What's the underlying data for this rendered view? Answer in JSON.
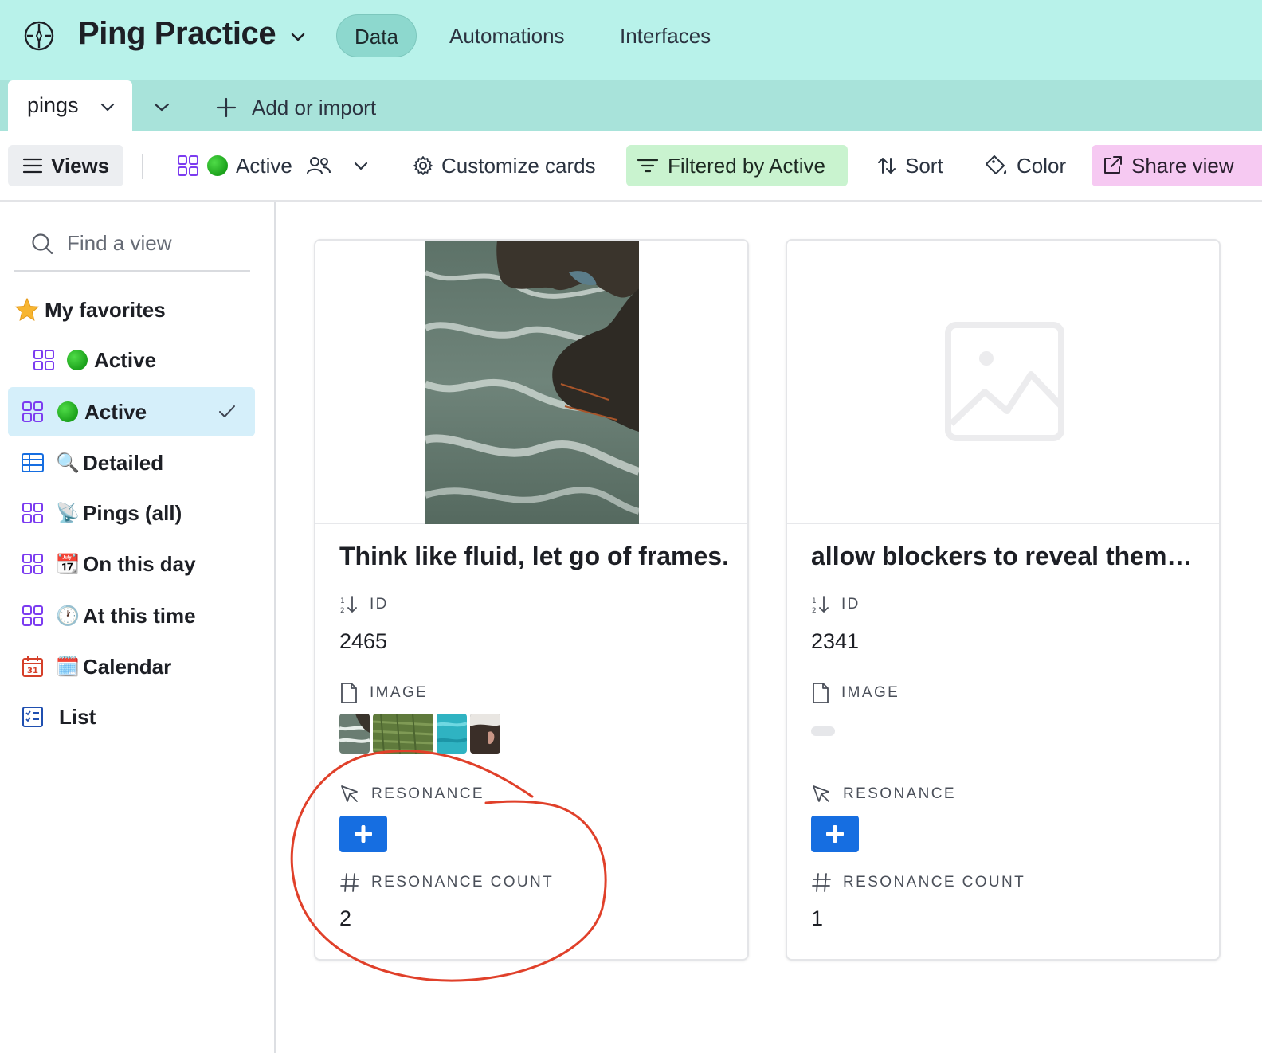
{
  "app": {
    "title": "Ping Practice",
    "nav_tabs": [
      {
        "label": "Data",
        "active": true
      },
      {
        "label": "Automations",
        "active": false
      },
      {
        "label": "Interfaces",
        "active": false
      }
    ]
  },
  "tables": {
    "current": "pings",
    "add_import": "Add or import"
  },
  "toolbar": {
    "views_label": "Views",
    "current_view": "Active",
    "customize": "Customize cards",
    "filter": "Filtered by Active",
    "sort": "Sort",
    "color": "Color",
    "share": "Share view"
  },
  "sidebar": {
    "search_placeholder": "Find a view",
    "favorites_header": "My favorites",
    "favorites": [
      {
        "label": "Active",
        "icon": "gallery-icon",
        "emoji": "green-circle"
      }
    ],
    "views": [
      {
        "label": "Active",
        "icon": "gallery-icon",
        "emoji": "green-circle",
        "selected": true
      },
      {
        "label": "Detailed",
        "icon": "grid-icon",
        "emoji": "🔍"
      },
      {
        "label": "Pings (all)",
        "icon": "gallery-icon",
        "emoji": "📡"
      },
      {
        "label": "On this day",
        "icon": "gallery-icon",
        "emoji": "📆"
      },
      {
        "label": "At this time",
        "icon": "gallery-icon",
        "emoji": "🕐"
      },
      {
        "label": "Calendar",
        "icon": "calendar-icon",
        "emoji": "🗓️"
      },
      {
        "label": "List",
        "icon": "list-icon",
        "emoji": ""
      }
    ]
  },
  "cards": [
    {
      "title": "Think like fluid, let go of frames.",
      "id_label": "ID",
      "id_value": "2465",
      "image_label": "IMAGE",
      "image_count": 4,
      "resonance_label": "RESONANCE",
      "resonance_count_label": "RESONANCE COUNT",
      "resonance_count": "2"
    },
    {
      "title": "allow blockers to reveal thems...",
      "id_label": "ID",
      "id_value": "2341",
      "image_label": "IMAGE",
      "image_count": 0,
      "resonance_label": "RESONANCE",
      "resonance_count_label": "RESONANCE COUNT",
      "resonance_count": "1"
    }
  ],
  "colors": {
    "appbar": "#b8f2ea",
    "tabbar": "#a8e3da",
    "filter_bg": "#c9f3cf",
    "share_bg": "#f6c9f2",
    "selected_view": "#d5effa",
    "button_blue": "#166ee1",
    "annotation_red": "#e0402a"
  }
}
